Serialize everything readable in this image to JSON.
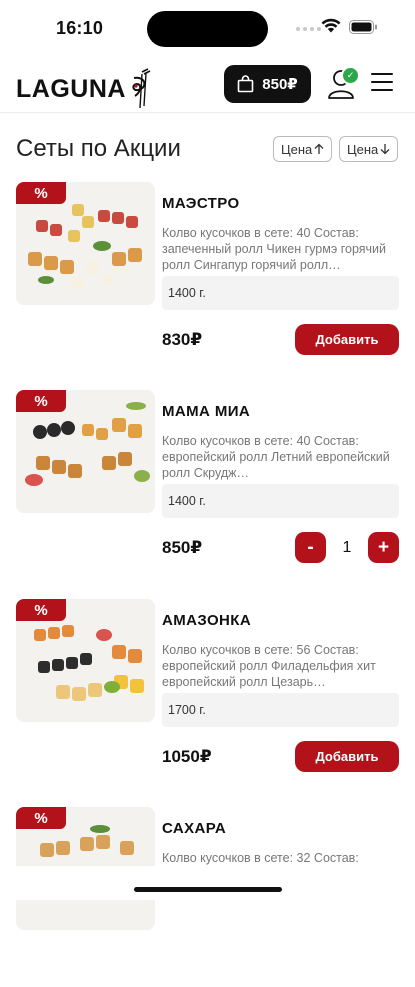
{
  "status": {
    "time": "16:10"
  },
  "header": {
    "logo": "LAGUNA",
    "cart_total": "850₽"
  },
  "page": {
    "title": "Сеты по Акции"
  },
  "sort": {
    "asc_label": "Цена",
    "desc_label": "Цена"
  },
  "colors": {
    "accent": "#b3121a",
    "badge": "#2aa84a",
    "dark": "#111111"
  },
  "products": [
    {
      "name": "МАЭСТРО",
      "description": "Колво кусочков в сете: 40 Состав: запеченный ролл Чикен гурмэ горячий ролл Сингапур горячий ролл…",
      "weight": "1400 г.",
      "price": "830₽",
      "promo": "%",
      "action": "Добавить"
    },
    {
      "name": "МАМА МИА",
      "description": "Колво кусочков в сете: 40 Состав: европейский ролл Летний европейский ролл Скрудж…",
      "weight": "1400 г.",
      "price": "850₽",
      "promo": "%",
      "quantity": "1",
      "minus": "-",
      "plus": "+"
    },
    {
      "name": "АМАЗОНКА",
      "description": "Колво кусочков в сете: 56 Состав: европейский ролл Филадельфия хит европейский ролл Цезарь…",
      "weight": "1700 г.",
      "price": "1050₽",
      "promo": "%",
      "action": "Добавить"
    },
    {
      "name": "САХАРА",
      "description": "Колво кусочков в сете: 32 Состав:",
      "promo": "%"
    }
  ]
}
